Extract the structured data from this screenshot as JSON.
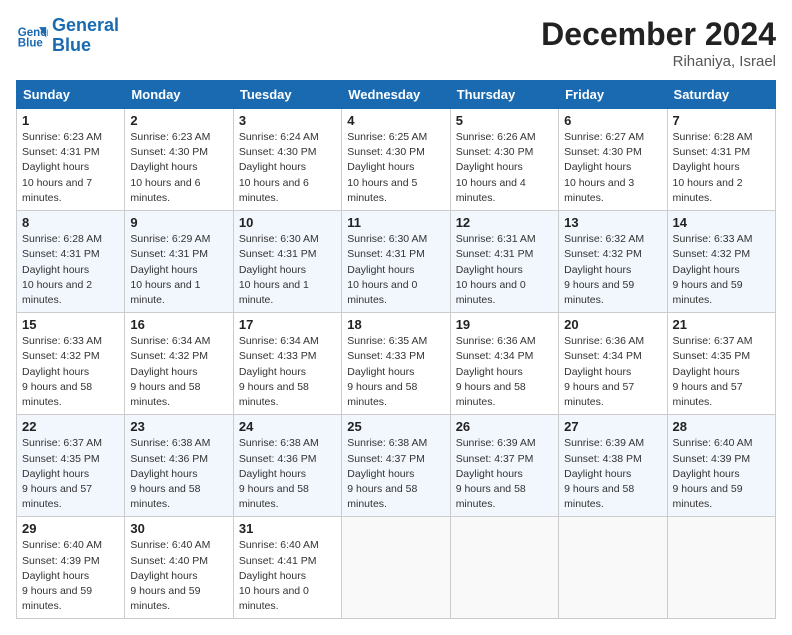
{
  "header": {
    "logo_line1": "General",
    "logo_line2": "Blue",
    "month": "December 2024",
    "location": "Rihaniya, Israel"
  },
  "weekdays": [
    "Sunday",
    "Monday",
    "Tuesday",
    "Wednesday",
    "Thursday",
    "Friday",
    "Saturday"
  ],
  "weeks": [
    [
      {
        "day": "1",
        "sunrise": "6:23 AM",
        "sunset": "4:31 PM",
        "daylight": "10 hours and 7 minutes."
      },
      {
        "day": "2",
        "sunrise": "6:23 AM",
        "sunset": "4:30 PM",
        "daylight": "10 hours and 6 minutes."
      },
      {
        "day": "3",
        "sunrise": "6:24 AM",
        "sunset": "4:30 PM",
        "daylight": "10 hours and 6 minutes."
      },
      {
        "day": "4",
        "sunrise": "6:25 AM",
        "sunset": "4:30 PM",
        "daylight": "10 hours and 5 minutes."
      },
      {
        "day": "5",
        "sunrise": "6:26 AM",
        "sunset": "4:30 PM",
        "daylight": "10 hours and 4 minutes."
      },
      {
        "day": "6",
        "sunrise": "6:27 AM",
        "sunset": "4:30 PM",
        "daylight": "10 hours and 3 minutes."
      },
      {
        "day": "7",
        "sunrise": "6:28 AM",
        "sunset": "4:31 PM",
        "daylight": "10 hours and 2 minutes."
      }
    ],
    [
      {
        "day": "8",
        "sunrise": "6:28 AM",
        "sunset": "4:31 PM",
        "daylight": "10 hours and 2 minutes."
      },
      {
        "day": "9",
        "sunrise": "6:29 AM",
        "sunset": "4:31 PM",
        "daylight": "10 hours and 1 minute."
      },
      {
        "day": "10",
        "sunrise": "6:30 AM",
        "sunset": "4:31 PM",
        "daylight": "10 hours and 1 minute."
      },
      {
        "day": "11",
        "sunrise": "6:30 AM",
        "sunset": "4:31 PM",
        "daylight": "10 hours and 0 minutes."
      },
      {
        "day": "12",
        "sunrise": "6:31 AM",
        "sunset": "4:31 PM",
        "daylight": "10 hours and 0 minutes."
      },
      {
        "day": "13",
        "sunrise": "6:32 AM",
        "sunset": "4:32 PM",
        "daylight": "9 hours and 59 minutes."
      },
      {
        "day": "14",
        "sunrise": "6:33 AM",
        "sunset": "4:32 PM",
        "daylight": "9 hours and 59 minutes."
      }
    ],
    [
      {
        "day": "15",
        "sunrise": "6:33 AM",
        "sunset": "4:32 PM",
        "daylight": "9 hours and 58 minutes."
      },
      {
        "day": "16",
        "sunrise": "6:34 AM",
        "sunset": "4:32 PM",
        "daylight": "9 hours and 58 minutes."
      },
      {
        "day": "17",
        "sunrise": "6:34 AM",
        "sunset": "4:33 PM",
        "daylight": "9 hours and 58 minutes."
      },
      {
        "day": "18",
        "sunrise": "6:35 AM",
        "sunset": "4:33 PM",
        "daylight": "9 hours and 58 minutes."
      },
      {
        "day": "19",
        "sunrise": "6:36 AM",
        "sunset": "4:34 PM",
        "daylight": "9 hours and 58 minutes."
      },
      {
        "day": "20",
        "sunrise": "6:36 AM",
        "sunset": "4:34 PM",
        "daylight": "9 hours and 57 minutes."
      },
      {
        "day": "21",
        "sunrise": "6:37 AM",
        "sunset": "4:35 PM",
        "daylight": "9 hours and 57 minutes."
      }
    ],
    [
      {
        "day": "22",
        "sunrise": "6:37 AM",
        "sunset": "4:35 PM",
        "daylight": "9 hours and 57 minutes."
      },
      {
        "day": "23",
        "sunrise": "6:38 AM",
        "sunset": "4:36 PM",
        "daylight": "9 hours and 58 minutes."
      },
      {
        "day": "24",
        "sunrise": "6:38 AM",
        "sunset": "4:36 PM",
        "daylight": "9 hours and 58 minutes."
      },
      {
        "day": "25",
        "sunrise": "6:38 AM",
        "sunset": "4:37 PM",
        "daylight": "9 hours and 58 minutes."
      },
      {
        "day": "26",
        "sunrise": "6:39 AM",
        "sunset": "4:37 PM",
        "daylight": "9 hours and 58 minutes."
      },
      {
        "day": "27",
        "sunrise": "6:39 AM",
        "sunset": "4:38 PM",
        "daylight": "9 hours and 58 minutes."
      },
      {
        "day": "28",
        "sunrise": "6:40 AM",
        "sunset": "4:39 PM",
        "daylight": "9 hours and 59 minutes."
      }
    ],
    [
      {
        "day": "29",
        "sunrise": "6:40 AM",
        "sunset": "4:39 PM",
        "daylight": "9 hours and 59 minutes."
      },
      {
        "day": "30",
        "sunrise": "6:40 AM",
        "sunset": "4:40 PM",
        "daylight": "9 hours and 59 minutes."
      },
      {
        "day": "31",
        "sunrise": "6:40 AM",
        "sunset": "4:41 PM",
        "daylight": "10 hours and 0 minutes."
      },
      null,
      null,
      null,
      null
    ]
  ]
}
